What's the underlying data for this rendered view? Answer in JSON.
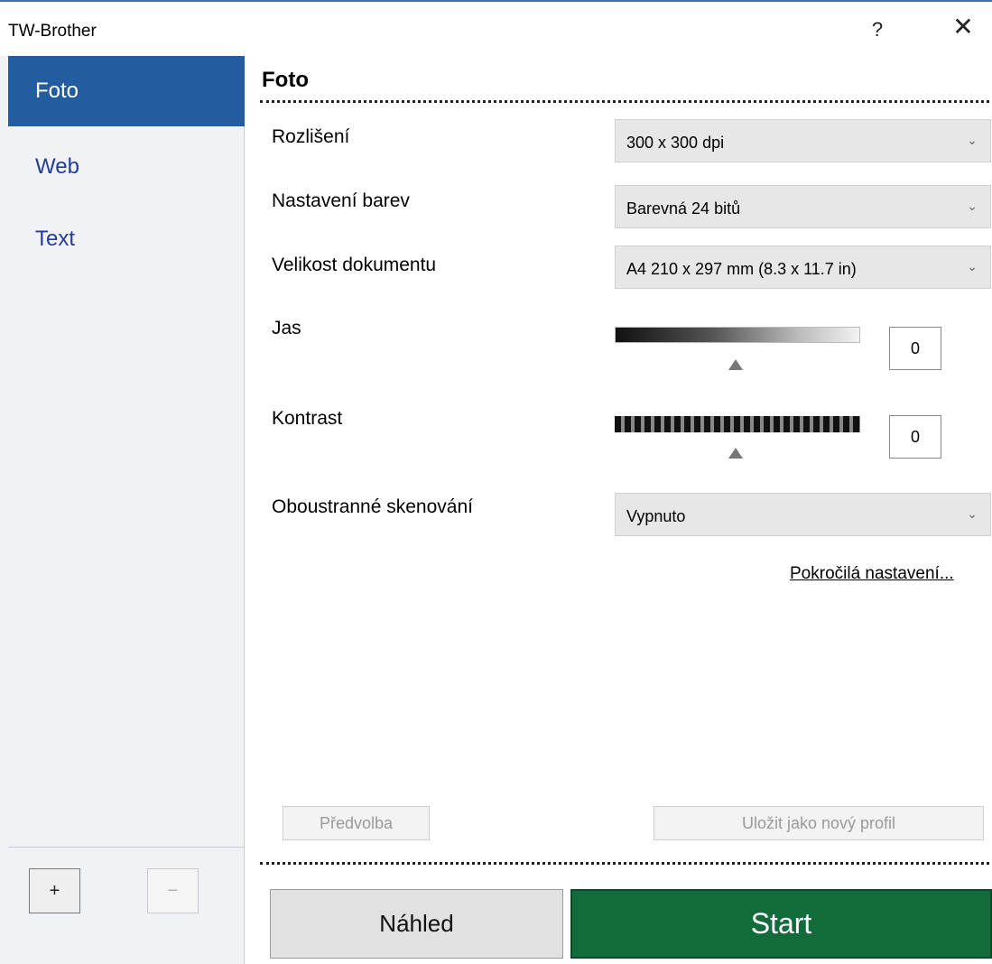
{
  "window": {
    "title": "TW-Brother",
    "help_label": "?",
    "close_label": "✕"
  },
  "sidebar": {
    "items": [
      {
        "label": "Foto",
        "active": true
      },
      {
        "label": "Web",
        "active": false
      },
      {
        "label": "Text",
        "active": false
      }
    ],
    "add_label": "+",
    "remove_label": "−"
  },
  "main": {
    "title": "Foto",
    "resolution": {
      "label": "Rozlišení",
      "value": "300 x 300 dpi"
    },
    "color": {
      "label": "Nastavení barev",
      "value": "Barevná 24 bitů"
    },
    "size": {
      "label": "Velikost dokumentu",
      "value": "A4 210 x 297 mm (8.3 x 11.7 in)"
    },
    "brightness": {
      "label": "Jas",
      "value": "0"
    },
    "contrast": {
      "label": "Kontrast",
      "value": "0"
    },
    "duplex": {
      "label": "Oboustranné skenování",
      "value": "Vypnuto"
    },
    "advanced_link": "Pokročilá nastavení...",
    "preset_button": "Předvolba",
    "save_profile_button": "Uložit jako nový profil",
    "preview_button": "Náhled",
    "start_button": "Start"
  },
  "colors": {
    "accent": "#245ca0",
    "start": "#126b3a",
    "nav_text": "#243c9a"
  }
}
